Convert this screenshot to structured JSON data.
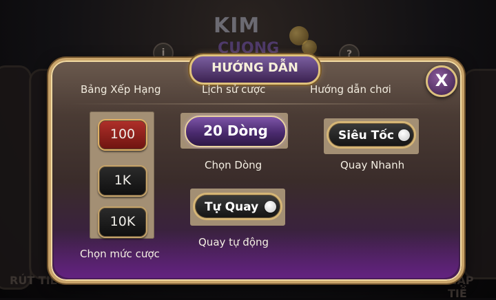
{
  "background": {
    "logo_line1": "KIM",
    "logo_line2": "CUONG",
    "info_icon_glyph": "i",
    "help_icon_glyph": "?",
    "left_bottom_text": "RÚT TIỀ",
    "right_bottom_text": "NẠP TIỀ"
  },
  "dialog": {
    "title": "HƯỚNG DẪN",
    "close_glyph": "X"
  },
  "tabs": [
    {
      "label": "Bảng Xếp Hạng"
    },
    {
      "label": "Lịch sử cược"
    },
    {
      "label": "Hướng dẫn chơi"
    }
  ],
  "bet": {
    "options": [
      "100",
      "1K",
      "10K"
    ],
    "selected": "100",
    "caption": "Chọn mức cược"
  },
  "lines": {
    "value": "20 Dòng",
    "caption": "Chọn Dòng"
  },
  "turbo": {
    "label": "Siêu Tốc",
    "caption": "Quay Nhanh",
    "enabled": false
  },
  "auto_spin": {
    "label": "Tự Quay",
    "caption": "Quay tự động",
    "enabled": false
  }
}
